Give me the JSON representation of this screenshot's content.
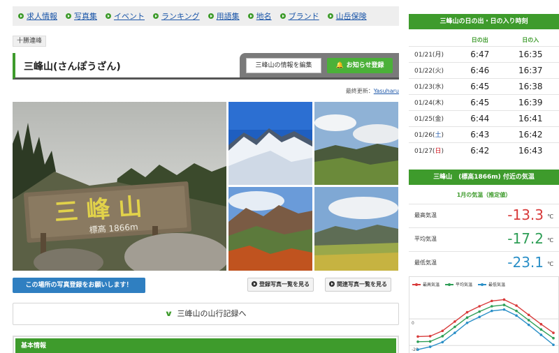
{
  "nav": {
    "items": [
      "求人情報",
      "写真集",
      "イベント",
      "ランキング",
      "用語集",
      "地名",
      "ブランド",
      "山岳保険"
    ]
  },
  "area_tag": "十勝連峰",
  "title": "三峰山(さんぽうざん)",
  "buttons": {
    "edit": "三峰山の情報を編集",
    "notify": "お知らせ登録",
    "upload": "この場所の写真登録をお願いします！",
    "photo_list": "登録写真一覧を見る",
    "related_list": "関連写真一覧を見る",
    "records": "三峰山の山行記録へ"
  },
  "last_update": {
    "label": "最終更新：",
    "user": "Yasuharu"
  },
  "photos": {
    "sign_main": "三 峰 山",
    "sign_sub": "標高 1866m"
  },
  "basic_info": "基本情報",
  "sun": {
    "title": "三峰山の日の出・日の入り時刻",
    "col_rise": "日の出",
    "col_set": "日の入",
    "rows": [
      {
        "date": "01/21(",
        "wd": "月",
        "tail": ")",
        "rise": "6:47",
        "set": "16:35",
        "kind": ""
      },
      {
        "date": "01/22(",
        "wd": "火",
        "tail": ")",
        "rise": "6:46",
        "set": "16:37",
        "kind": ""
      },
      {
        "date": "01/23(",
        "wd": "水",
        "tail": ")",
        "rise": "6:45",
        "set": "16:38",
        "kind": ""
      },
      {
        "date": "01/24(",
        "wd": "木",
        "tail": ")",
        "rise": "6:45",
        "set": "16:39",
        "kind": ""
      },
      {
        "date": "01/25(",
        "wd": "金",
        "tail": ")",
        "rise": "6:44",
        "set": "16:41",
        "kind": ""
      },
      {
        "date": "01/26(",
        "wd": "土",
        "tail": ")",
        "rise": "6:43",
        "set": "16:42",
        "kind": "sat"
      },
      {
        "date": "01/27(",
        "wd": "日",
        "tail": ")",
        "rise": "6:42",
        "set": "16:43",
        "kind": "sun"
      }
    ]
  },
  "temp": {
    "title": "三峰山　(標高1866m) 付近の気温",
    "subtitle": "1月の気温（推定値）",
    "max_label": "最高気温",
    "max_value": "-13.3",
    "avg_label": "平均気温",
    "avg_value": "-17.2",
    "min_label": "最低気温",
    "min_value": "-23.1",
    "unit": "℃"
  },
  "colors": {
    "accent_green": "#3e9b2c",
    "max_red": "#d83a3a",
    "avg_green": "#2e9e56",
    "min_blue": "#2a8fc7"
  },
  "chart_data": {
    "type": "line",
    "x": [
      1,
      2,
      3,
      4,
      5,
      6,
      7,
      8,
      9,
      10,
      11,
      12
    ],
    "series": [
      {
        "name": "最高気温",
        "values": [
          -13.3,
          -13.0,
          -9.0,
          -2.0,
          5.0,
          9.5,
          13.5,
          14.5,
          10.0,
          3.0,
          -4.0,
          -10.5
        ]
      },
      {
        "name": "平均気温",
        "values": [
          -17.2,
          -17.0,
          -13.0,
          -6.0,
          1.0,
          5.5,
          9.5,
          10.5,
          6.0,
          -1.0,
          -8.0,
          -14.5
        ]
      },
      {
        "name": "最低気温",
        "values": [
          -23.1,
          -21.0,
          -17.5,
          -10.5,
          -3.0,
          1.5,
          6.0,
          7.0,
          2.5,
          -4.5,
          -12.0,
          -19.5
        ]
      }
    ],
    "yticks": [
      "0",
      "-20"
    ],
    "ylim": [
      -22,
      20
    ]
  }
}
